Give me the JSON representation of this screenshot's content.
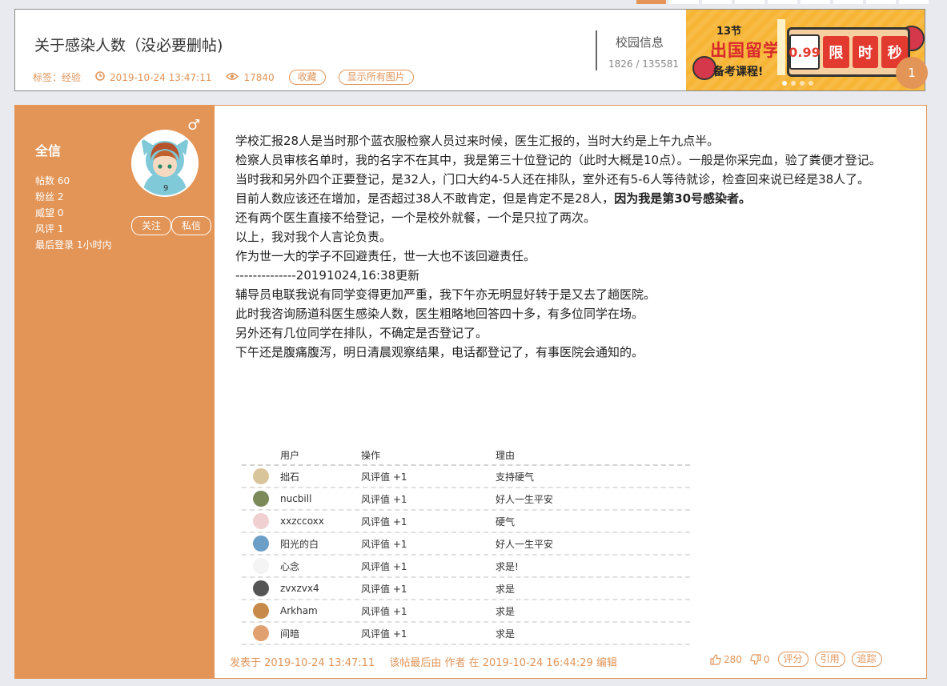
{
  "header": {
    "title": "关于感染人数（没必要删帖)",
    "tag_label": "标签：",
    "tag_value": "经验",
    "post_time": "2019-10-24 13:47:11",
    "views": "17840",
    "favorite_btn": "收藏",
    "show_images_btn": "显示所有图片",
    "forum_name": "校园信息",
    "forum_count": "1826 / 135581"
  },
  "banner": {
    "line1": "13节",
    "line2": "出国留学",
    "line3": "备考课程!",
    "price": "0.99",
    "c1": "限",
    "c2": "时",
    "c3": "秒"
  },
  "user": {
    "name": "全信",
    "gender_symbol": "♂",
    "posts": "帖数 60",
    "fans": "粉丝 2",
    "prestige": "威望 0",
    "rating": "风评 1",
    "last_login": "最后登录 1小时内",
    "follow_btn": "关注",
    "message_btn": "私信"
  },
  "floor": "1",
  "content": {
    "p1": "学校汇报28人是当时那个蓝衣服检察人员过来时候，医生汇报的，当时大约是上午九点半。",
    "p2": "检察人员审核名单时，我的名字不在其中，我是第三十位登记的（此时大概是10点）。一般是你采完血，验了粪便才登记。",
    "p3": "当时我和另外四个正要登记，是32人，门口大约4-5人还在排队，室外还有5-6人等待就诊，检查回来说已经是38人了。",
    "p4a": "目前人数应该还在增加，是否超过38人不敢肯定，但是肯定不是28人，",
    "p4b": "因为我是第30号感染者。",
    "p5": "还有两个医生直接不给登记，一个是校外就餐，一个是只拉了两次。",
    "p6": "以上，我对我个人言论负责。",
    "p7": "作为世一大的学子不回避责任，世一大也不该回避责任。",
    "p8": "--------------20191024,16:38更新",
    "p9": "辅导员电联我说有同学变得更加严重，我下午亦无明显好转于是又去了趟医院。",
    "p10": "此时我咨询肠道科医生感染人数，医生粗略地回答四十多，有多位同学在场。",
    "p11": "另外还有几位同学在排队，不确定是否登记了。",
    "p12": "下午还是腹痛腹泻，明日清晨观察结果，电话都登记了，有事医院会通知的。"
  },
  "ratings": {
    "headers": {
      "user": "用户",
      "op": "操作",
      "reason": "理由"
    },
    "rows": [
      {
        "user": "拙石",
        "op": "风评值 +1",
        "reason": "支持硬气",
        "color": "#d8c59a"
      },
      {
        "user": "nucbill",
        "op": "风评值 +1",
        "reason": "好人一生平安",
        "color": "#7c8a5a"
      },
      {
        "user": "xxzccoxx",
        "op": "风评值 +1",
        "reason": "硬气",
        "color": "#f0d0d0"
      },
      {
        "user": "阳光的白",
        "op": "风评值 +1",
        "reason": "好人一生平安",
        "color": "#6c9fc8"
      },
      {
        "user": "心念",
        "op": "风评值 +1",
        "reason": "求是!",
        "color": "#f4f4f4"
      },
      {
        "user": "zvxzvx4",
        "op": "风评值 +1",
        "reason": "求是",
        "color": "#555555"
      },
      {
        "user": "Arkham",
        "op": "风评值 +1",
        "reason": "求是",
        "color": "#c88a4a"
      },
      {
        "user": "间暗",
        "op": "风评值 +1",
        "reason": "求是",
        "color": "#e0a070"
      }
    ]
  },
  "footer": {
    "posted_at": "发表于 2019-10-24 13:47:11",
    "edited": "该帖最后由 作者 在 2019-10-24 16:44:29 编辑",
    "likes": "280",
    "dislikes": "0",
    "rate_btn": "评分",
    "quote_btn": "引用",
    "report_btn": "追踪"
  }
}
